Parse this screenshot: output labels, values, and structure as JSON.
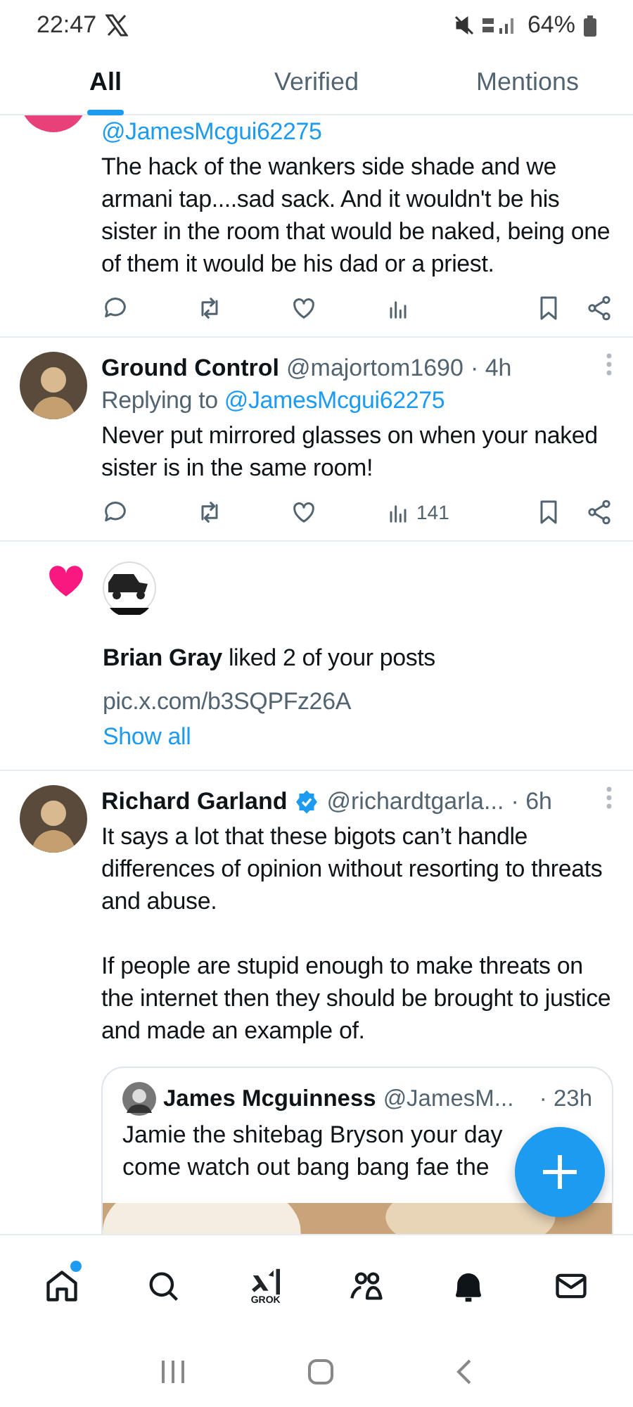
{
  "status_bar": {
    "time": "22:47",
    "battery": "64%"
  },
  "tabs": [
    {
      "label": "All",
      "selected": true
    },
    {
      "label": "Verified",
      "selected": false
    },
    {
      "label": "Mentions",
      "selected": false
    }
  ],
  "feed": [
    {
      "kind": "tweet",
      "reply_to": "@JamesMcgui62275",
      "text": "The hack of the wankers side shade and we armani tap....sad sack. And it wouldn't be his sister in the room that would be naked, being one of them it would be his dad or a priest."
    },
    {
      "kind": "tweet",
      "name": "Ground Control",
      "handle": "@majortom1690",
      "time": "· 4h",
      "reply_label": "Replying to",
      "reply_to": "@JamesMcgui62275",
      "text": "Never put mirrored glasses on when your naked sister is in the same room!",
      "views": "141"
    },
    {
      "kind": "like",
      "name": "Brian Gray",
      "action": "liked 2 of your posts",
      "link": "pic.x.com/b3SQPFz26A",
      "show_all": "Show all"
    },
    {
      "kind": "tweet",
      "name": "Richard Garland",
      "verified": true,
      "handle": "@richardtgarla...",
      "time": "· 6h",
      "paragraphs": [
        "It says a lot that these bigots can’t handle differences of opinion without resorting to threats and abuse.",
        "If people are stupid enough to make threats on the internet then they should be brought to justice and made an example of."
      ],
      "quote": {
        "name": "James Mcguinness",
        "handle": "@JamesM...",
        "time": "· 23h",
        "lines": [
          "Jamie the shitebag Bryson your day",
          "come watch out bang bang fae the"
        ],
        "media": {
          "kind": "picture"
        }
      }
    }
  ],
  "nav": [
    {
      "badge": true,
      "selected": false
    },
    {
      "badge": false,
      "selected": false
    },
    {
      "label": "GROK",
      "badge": false,
      "selected": false
    },
    {
      "badge": false,
      "selected": false
    },
    {
      "badge": false,
      "selected": true
    },
    {
      "badge": false,
      "selected": false
    }
  ]
}
